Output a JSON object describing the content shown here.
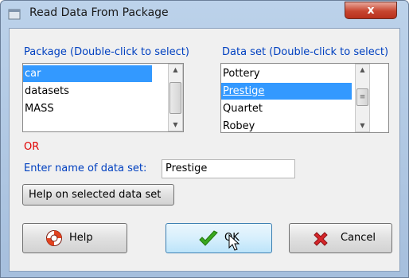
{
  "window": {
    "title": "Read Data From Package",
    "close_glyph": "x"
  },
  "package_list": {
    "label": "Package (Double-click to select)",
    "items": [
      {
        "label": "car",
        "selected": true
      },
      {
        "label": "datasets",
        "selected": false
      },
      {
        "label": "MASS",
        "selected": false
      }
    ]
  },
  "dataset_list": {
    "label": "Data set (Double-click to select)",
    "items": [
      {
        "label": "Pottery",
        "selected": false
      },
      {
        "label": "Prestige",
        "selected": true
      },
      {
        "label": "Quartet",
        "selected": false
      },
      {
        "label": "Robey",
        "selected": false
      }
    ]
  },
  "or_label": "OR",
  "name_field": {
    "label": "Enter name of data set:",
    "value": "Prestige"
  },
  "buttons": {
    "help_dataset": "Help on selected data set",
    "help": "Help",
    "ok": "OK",
    "cancel": "Cancel"
  },
  "icons": {
    "app": "window-app-icon",
    "help": "lifebuoy-icon",
    "ok": "checkmark-icon",
    "cancel": "red-x-icon",
    "cursor": "mouse-pointer-icon"
  },
  "colors": {
    "label_blue": "#0040c0",
    "or_red": "#e00000",
    "selection": "#3399ff",
    "ok_check": "#3aa81f",
    "cancel_x": "#d6262a"
  }
}
